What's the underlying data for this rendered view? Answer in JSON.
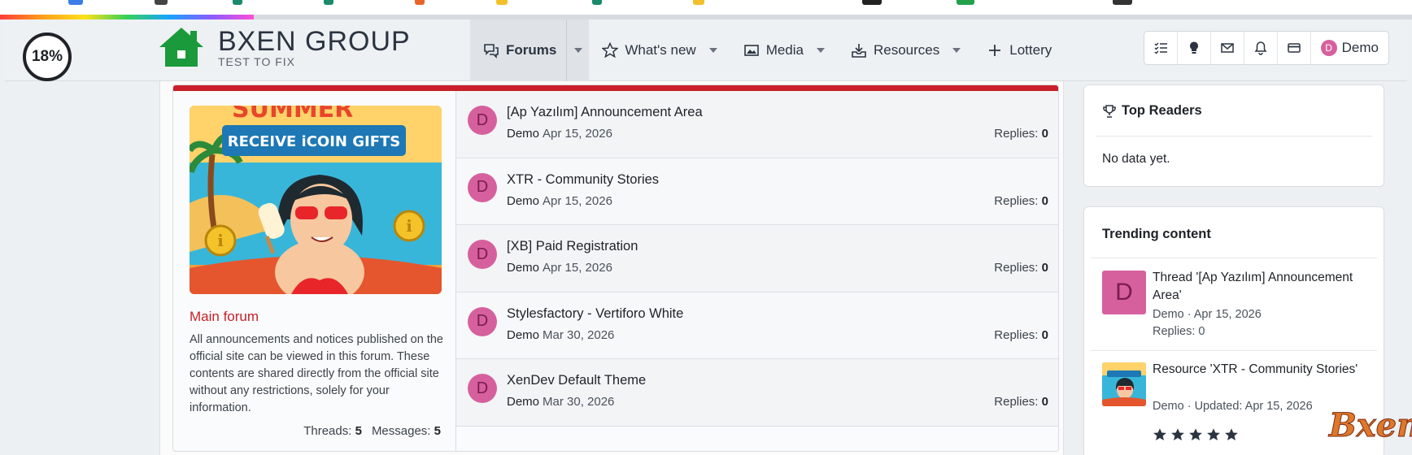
{
  "header": {
    "progress_label": "18%",
    "progress_value": 0.18,
    "logo_title": "BXEN GROUP",
    "logo_subtitle": "TEST TO FIX",
    "nav": [
      {
        "label": "Forums",
        "icon": "chat-bubbles-icon",
        "active": true
      },
      {
        "label": "What's new",
        "icon": "star-icon"
      },
      {
        "label": "Media",
        "icon": "image-icon"
      },
      {
        "label": "Resources",
        "icon": "download-tray-icon"
      },
      {
        "label": "Lottery",
        "icon": "plus-icon"
      }
    ],
    "user_name": "Demo",
    "user_initial": "D"
  },
  "feature": {
    "image_text_top": "SUMMER",
    "image_text_banner": "RECEIVE iCOIN GIFTS",
    "title": "Main forum",
    "description": "All announcements and notices published on the official site can be viewed in this forum. These contents are shared directly from the official site without any restrictions, solely for your information.",
    "threads_label": "Threads:",
    "threads_value": "5",
    "messages_label": "Messages:",
    "messages_value": "5"
  },
  "threads": [
    {
      "initial": "D",
      "title": "[Ap Yazılım] Announcement Area",
      "author": "Demo",
      "date": "Apr 15, 2026",
      "replies_label": "Replies:",
      "replies": "0"
    },
    {
      "initial": "D",
      "title": "XTR - Community Stories",
      "author": "Demo",
      "date": "Apr 15, 2026",
      "replies_label": "Replies:",
      "replies": "0"
    },
    {
      "initial": "D",
      "title": "[XB] Paid Registration",
      "author": "Demo",
      "date": "Apr 15, 2026",
      "replies_label": "Replies:",
      "replies": "0"
    },
    {
      "initial": "D",
      "title": "Stylesfactory - Vertiforo White",
      "author": "Demo",
      "date": "Mar 30, 2026",
      "replies_label": "Replies:",
      "replies": "0"
    },
    {
      "initial": "D",
      "title": "XenDev Default Theme",
      "author": "Demo",
      "date": "Mar 30, 2026",
      "replies_label": "Replies:",
      "replies": "0"
    }
  ],
  "top_readers": {
    "title": "Top Readers",
    "empty_text": "No data yet."
  },
  "trending": {
    "title": "Trending content",
    "items": [
      {
        "initial": "D",
        "title": "Thread '[Ap Yazılım] Announcement Area'",
        "meta": "Demo · Apr 15, 2026",
        "extra": "Replies: 0"
      },
      {
        "title": "Resource 'XTR - Community Stories'",
        "meta": "Demo · Updated: Apr 15, 2026",
        "rating": 5
      }
    ]
  },
  "watermark": "Bxen",
  "colors": {
    "accent_red": "#c8202a",
    "avatar_pink": "#d6609d",
    "logo_green": "#1a9a3a"
  }
}
